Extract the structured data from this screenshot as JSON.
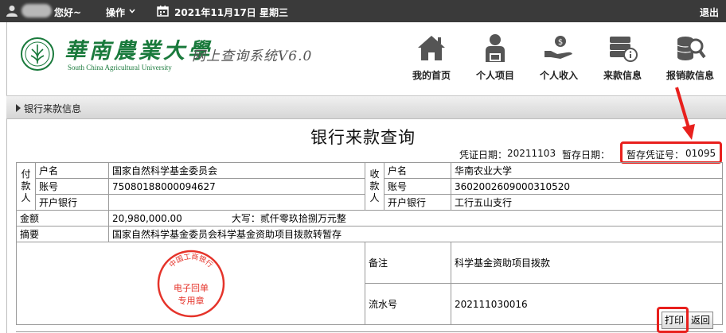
{
  "topbar": {
    "greeting": "您好~",
    "ops_label": "操作",
    "date": "2021年11月17日 星期三",
    "logout": "退出"
  },
  "header": {
    "uni_cn": "華南農業大學",
    "uni_en": "South China Agricultural University",
    "system_name": "网上查询系统V6.0",
    "nav": [
      {
        "label": "我的首页",
        "icon": "home-icon"
      },
      {
        "label": "个人项目",
        "icon": "person-icon"
      },
      {
        "label": "个人收入",
        "icon": "hand-money-icon"
      },
      {
        "label": "来款信息",
        "icon": "money-info-icon"
      },
      {
        "label": "报销款信息",
        "icon": "coins-search-icon"
      }
    ]
  },
  "section": {
    "title": "银行来款信息"
  },
  "voucher": {
    "title": "银行来款查询",
    "voucher_date_label": "凭证日期：",
    "voucher_date": "20211103",
    "temp_date_label": "暂存日期：",
    "temp_date": "",
    "temp_no_label": "暂存凭证号：",
    "temp_no": "01095",
    "payer_label": "付款人",
    "payee_label": "收款人",
    "name_label": "户名",
    "account_label": "账号",
    "bank_label": "开户银行",
    "payer_name": "国家自然科学基金委员会",
    "payer_account": "75080188000094627",
    "payer_bank": "",
    "payee_name": "华南农业大学",
    "payee_account": "3602002609000310520",
    "payee_bank": "工行五山支行",
    "amount_label": "金额",
    "amount": "20,980,000.00",
    "amount_upper_label": "大写：",
    "amount_upper": "贰仟零玖拾捌万元整",
    "summary_label": "摘要",
    "summary": "国家自然科学基金委员会科学基金资助项目拨款转暂存",
    "remark_label": "备注",
    "remark": "科学基金资助项目拨款",
    "serial_label": "流水号",
    "serial": "202111030016",
    "stamp_top": "中国工商银行",
    "stamp_line1": "电子回单",
    "stamp_line2": "专用章"
  },
  "buttons": {
    "print": "打印",
    "back": "返回"
  },
  "colors": {
    "accent_red": "#e8201d",
    "brand_green": "#1a7a3c",
    "topbar": "#3a3a3a"
  }
}
